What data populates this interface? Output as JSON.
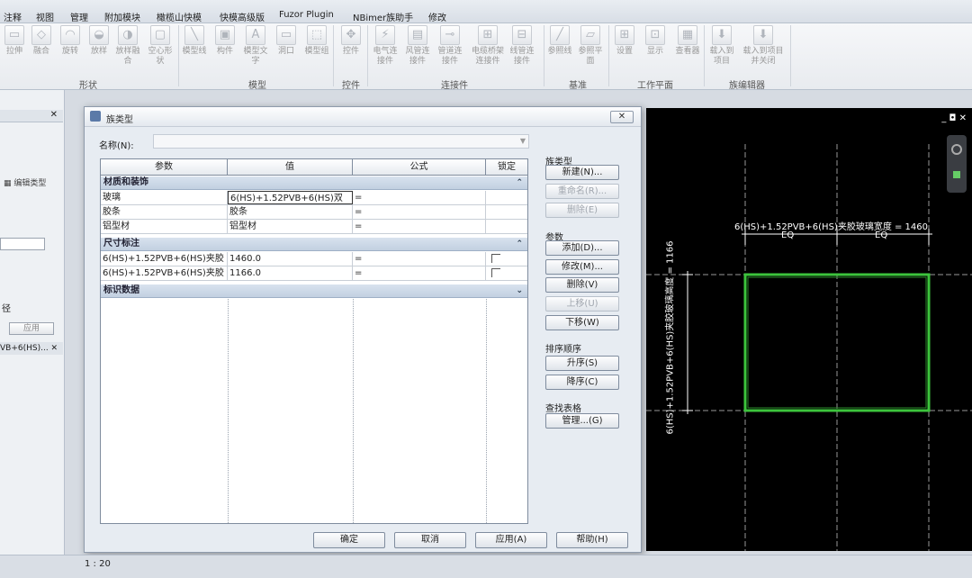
{
  "tabs": [
    "注释",
    "视图",
    "管理",
    "附加模块",
    "橄榄山快模",
    "快模高级版",
    "Fuzor Plugin",
    "NBimer族助手",
    "修改"
  ],
  "ribbon": {
    "groups": [
      {
        "label": "形状",
        "buttons": [
          "拉伸",
          "融合",
          "旋转",
          "放样",
          "放样融合",
          "空心形状"
        ]
      },
      {
        "label": "模型",
        "buttons": [
          "模型线",
          "构件",
          "模型文字",
          "洞口",
          "模型组"
        ]
      },
      {
        "label": "控件",
        "buttons": [
          "控件"
        ]
      },
      {
        "label": "连接件",
        "buttons": [
          "电气连接件",
          "风管连接件",
          "管道连接件",
          "电缆桥架连接件",
          "线管连接件"
        ]
      },
      {
        "label": "基准",
        "buttons": [
          "参照线",
          "参照平面"
        ]
      },
      {
        "label": "工作平面",
        "buttons": [
          "设置",
          "显示",
          "查看器"
        ]
      },
      {
        "label": "族编辑器",
        "buttons": [
          "载入到项目",
          "载入到项目并关闭"
        ]
      }
    ]
  },
  "left_panel": {
    "edit_type": "编辑类型",
    "item_jing": "径",
    "apply": "应用",
    "pvb_item": "VB+6(HS)..."
  },
  "dialog": {
    "title": "族类型",
    "name_label": "名称(N):",
    "name_value": "",
    "close": "✕",
    "columns": [
      "参数",
      "值",
      "公式",
      "锁定"
    ],
    "groups": [
      {
        "label": "材质和装饰",
        "chev": "⌃",
        "rows": [
          {
            "param": "玻璃",
            "value": "6(HS)+1.52PVB+6(HS)双",
            "formula": "=",
            "lock": false
          },
          {
            "param": "胶条",
            "value": "胶条",
            "formula": "=",
            "lock": false
          },
          {
            "param": "铝型材",
            "value": "铝型材",
            "formula": "=",
            "lock": false
          }
        ]
      },
      {
        "label": "尺寸标注",
        "chev": "⌃",
        "rows": [
          {
            "param": "6(HS)+1.52PVB+6(HS)夹胶",
            "value": "1460.0",
            "formula": "=",
            "lock": true
          },
          {
            "param": "6(HS)+1.52PVB+6(HS)夹胶",
            "value": "1166.0",
            "formula": "=",
            "lock": true
          }
        ]
      },
      {
        "label": "标识数据",
        "chev": "⌄",
        "rows": []
      }
    ],
    "family_types": {
      "title": "族类型",
      "new": "新建(N)...",
      "rename": "重命名(R)...",
      "delete": "删除(E)"
    },
    "params": {
      "title": "参数",
      "add": "添加(D)...",
      "modify": "修改(M)...",
      "delete": "删除(V)",
      "up": "上移(U)",
      "down": "下移(W)"
    },
    "sort": {
      "title": "排序顺序",
      "asc": "升序(S)",
      "desc": "降序(C)"
    },
    "lookup": {
      "title": "查找表格",
      "manage": "管理...(G)"
    },
    "buttons": {
      "ok": "确定",
      "cancel": "取消",
      "apply": "应用(A)",
      "help": "帮助(H)"
    }
  },
  "canvas": {
    "width_label": "6(HS)+1.52PVB+6(HS)夹胶玻璃宽度 = 1460",
    "eq1": "EQ",
    "eq2": "EQ",
    "height_label": "6(HS)+1.52PVB+6(HS)夹胶玻璃高度 = 1166",
    "window_controls": "_ ◘ ✕",
    "colors": {
      "frame": "#3cc43c",
      "dim": "#ffffff"
    }
  },
  "status": {
    "scale": "1 : 20"
  }
}
